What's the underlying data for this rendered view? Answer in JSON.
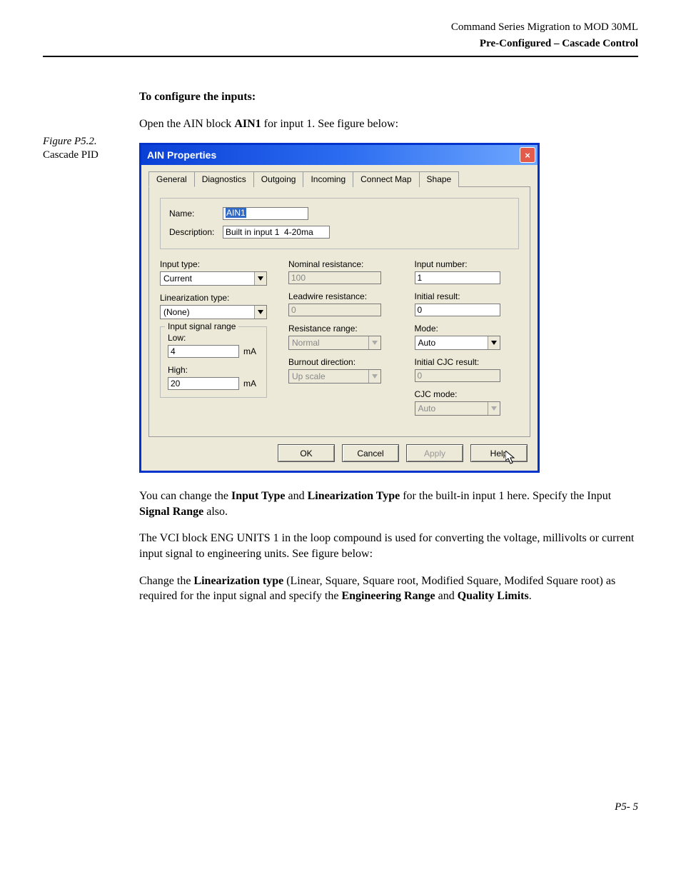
{
  "header": {
    "title": "Command Series Migration to MOD 30ML",
    "subtitle": "Pre-Configured – Cascade Control"
  },
  "figure": {
    "label": "Figure P5.2.",
    "caption": "Cascade PID"
  },
  "text": {
    "heading": "To configure the inputs:",
    "open_line_a": "Open the AIN block ",
    "open_line_b": "AIN1",
    "open_line_c": " for input 1. See figure below:",
    "p2a": "You can change the ",
    "p2b": "Input Type",
    "p2c": " and ",
    "p2d": "Linearization Type",
    "p2e": " for the built-in input 1 here. Specify the Input ",
    "p2f": "Signal Range",
    "p2g": " also.",
    "p3": "The VCI block ENG UNITS 1 in the loop compound is used for converting the voltage, millivolts or current input signal to engineering units. See figure below:",
    "p4a": "Change the ",
    "p4b": "Linearization type",
    "p4c": " (Linear, Square, Square root, Modified Square, Modifed Square root) as required for the input signal and specify the ",
    "p4d": "Engineering Range",
    "p4e": " and ",
    "p4f": "Quality Limits",
    "p4g": "."
  },
  "dialog": {
    "title": "AIN Properties",
    "close": "×",
    "tabs": [
      "General",
      "Diagnostics",
      "Outgoing",
      "Incoming",
      "Connect Map",
      "Shape"
    ],
    "name_label": "Name:",
    "name_value": "AIN1",
    "desc_label": "Description:",
    "desc_value": "Built in input 1  4-20ma",
    "col1": {
      "input_type_label": "Input type:",
      "input_type_value": "Current",
      "lin_type_label": "Linearization type:",
      "lin_type_value": "(None)",
      "range_legend": "Input signal range",
      "low_label": "Low:",
      "low_value": "4",
      "low_unit": "mA",
      "high_label": "High:",
      "high_value": "20",
      "high_unit": "mA"
    },
    "col2": {
      "nom_res_label": "Nominal resistance:",
      "nom_res_value": "100",
      "lead_res_label": "Leadwire resistance:",
      "lead_res_value": "0",
      "res_range_label": "Resistance range:",
      "res_range_value": "Normal",
      "burnout_label": "Burnout direction:",
      "burnout_value": "Up scale"
    },
    "col3": {
      "input_num_label": "Input number:",
      "input_num_value": "1",
      "init_res_label": "Initial result:",
      "init_res_value": "0",
      "mode_label": "Mode:",
      "mode_value": "Auto",
      "init_cjc_label": "Initial CJC result:",
      "init_cjc_value": "0",
      "cjc_mode_label": "CJC mode:",
      "cjc_mode_value": "Auto"
    },
    "buttons": {
      "ok": "OK",
      "cancel": "Cancel",
      "apply": "Apply",
      "help": "Help"
    }
  },
  "page_number": "P5- 5"
}
